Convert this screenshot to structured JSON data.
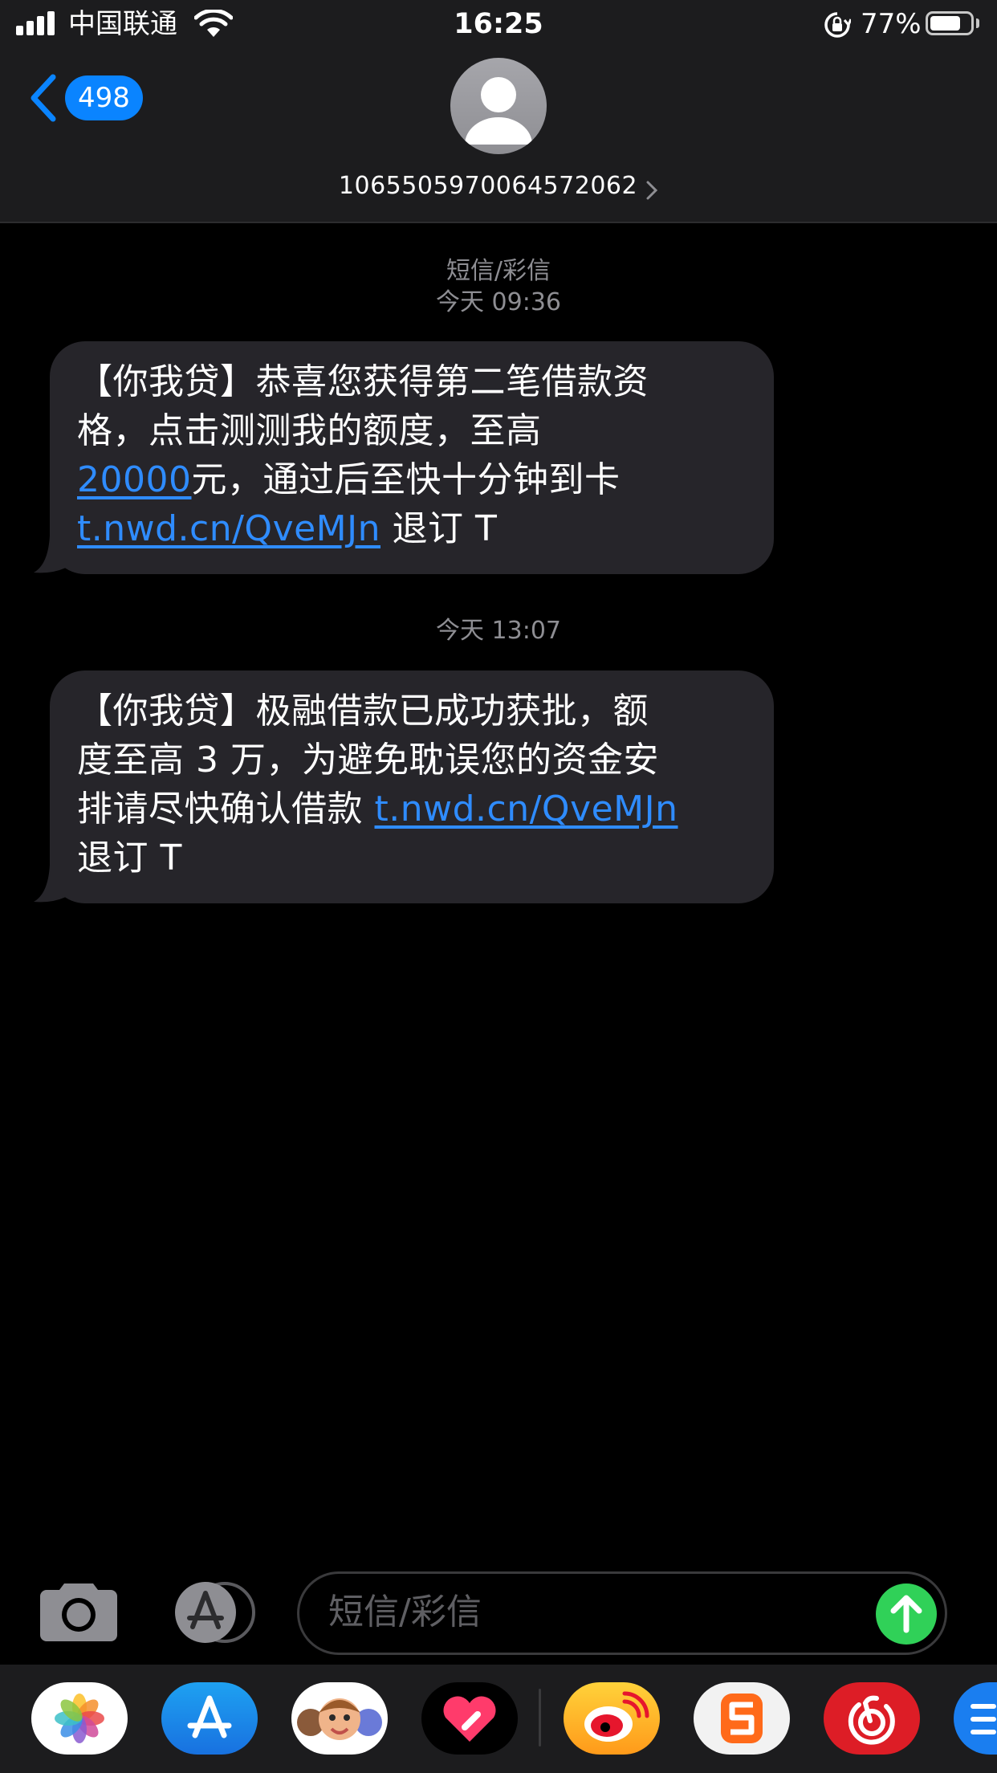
{
  "status_bar": {
    "carrier": "中国联通",
    "time": "16:25",
    "battery_percent_label": "77%",
    "battery_level": 0.77,
    "signal_bars": 4,
    "icons": [
      "signal-icon",
      "wifi-icon",
      "rotation-lock-icon",
      "battery-icon"
    ]
  },
  "header": {
    "back_badge_count": "498",
    "contact_number": "1065505970064572062",
    "icons": [
      "back-chevron-icon",
      "person-avatar-icon",
      "chevron-right-icon"
    ]
  },
  "conversation": {
    "header_label": "短信/彩信",
    "messages": [
      {
        "timestamp": "今天 09:36",
        "lines": [
          [
            {
              "text": "【你我贷】恭喜您获得第二笔借款资"
            }
          ],
          [
            {
              "text": "格，点击测测我的额度，至高"
            }
          ],
          [
            {
              "text": "20000",
              "link": true
            },
            {
              "text": "元，通过后至快十分钟到卡"
            }
          ],
          [
            {
              "text": "t.nwd.cn/QveMJn",
              "link": true
            },
            {
              "text": " 退订 T"
            }
          ]
        ]
      },
      {
        "timestamp": "今天 13:07",
        "lines": [
          [
            {
              "text": "【你我贷】极融借款已成功获批，额"
            }
          ],
          [
            {
              "text": "度至高 3 万，为避免耽误您的资金安"
            }
          ],
          [
            {
              "text": "排请尽快确认借款 "
            },
            {
              "text": "t.nwd.cn/QveMJn",
              "link": true
            }
          ],
          [
            {
              "text": "退订 T"
            }
          ]
        ]
      }
    ]
  },
  "compose": {
    "placeholder": "短信/彩信",
    "value": "",
    "icons": [
      "camera-icon",
      "app-store-icon",
      "send-arrow-icon"
    ]
  },
  "app_drawer": {
    "apps": [
      "photos-icon",
      "app-store-icon",
      "memoji-icon",
      "digital-touch-icon",
      "weibo-icon",
      "sogou-icon",
      "netease-music-icon",
      "partial-app-icon"
    ]
  },
  "colors": {
    "background": "#000000",
    "bar": "#1c1c1e",
    "bubble": "#26252a",
    "link": "#2f8cff",
    "accent_blue": "#0a84ff",
    "send_green": "#30d158",
    "timestamp": "#8e8e93"
  }
}
